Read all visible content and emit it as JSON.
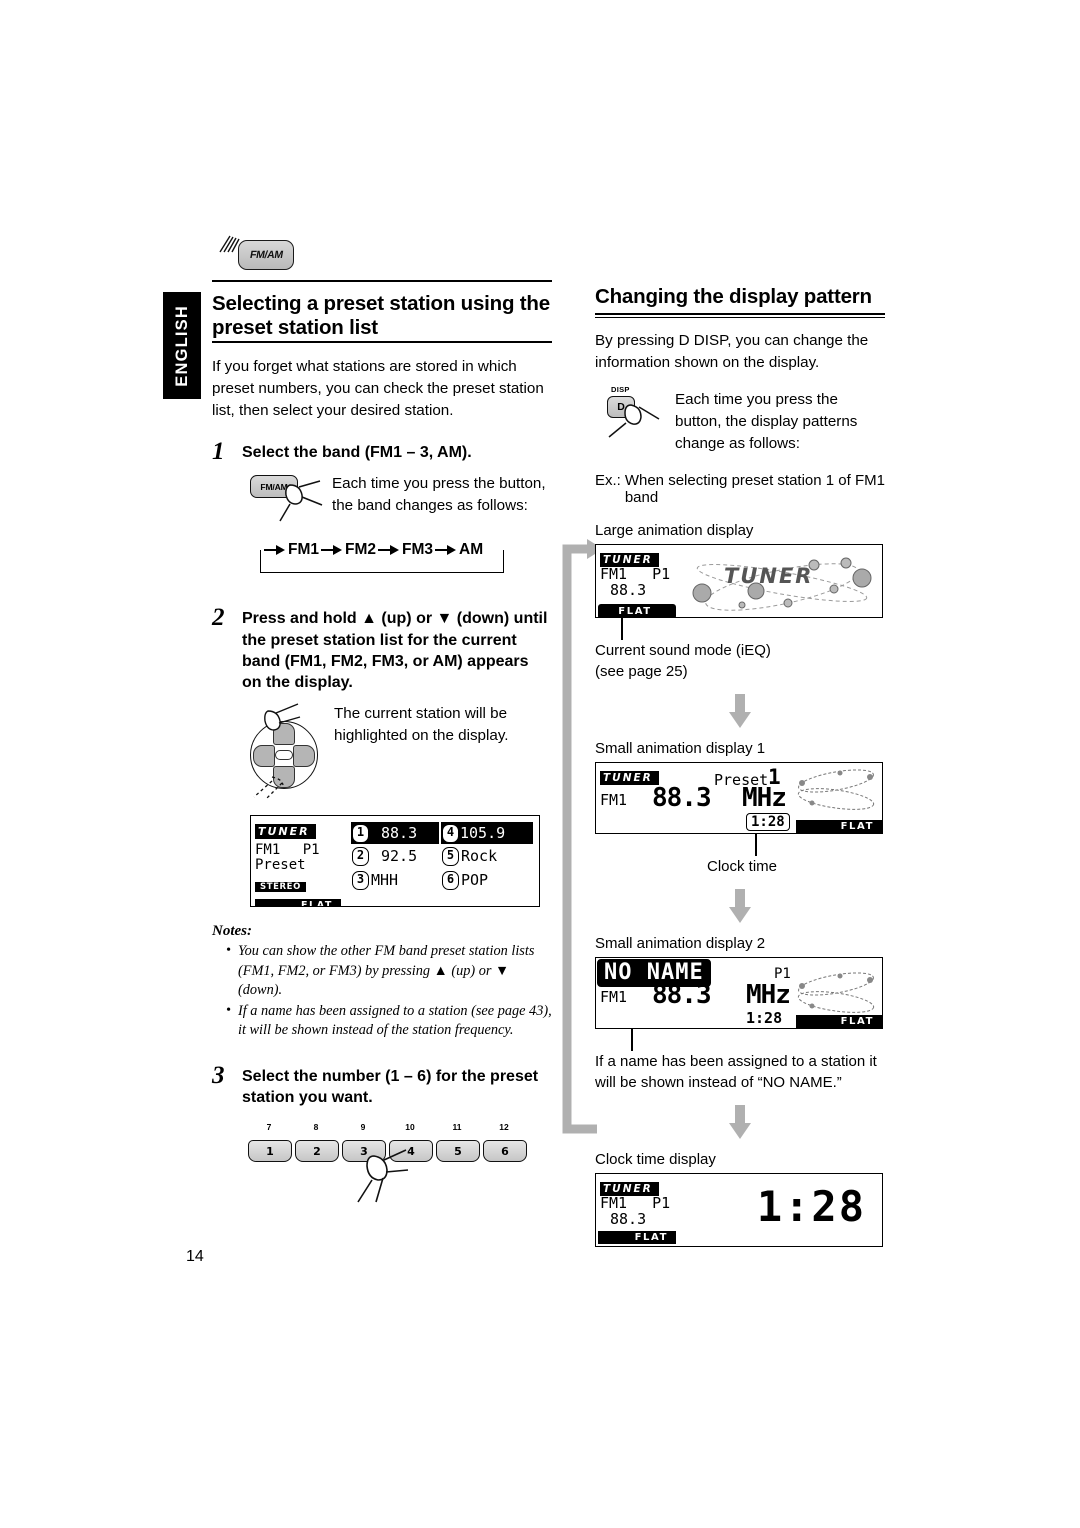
{
  "language_tab": "ENGLISH",
  "page_number": "14",
  "left_column": {
    "remote_button_label": "FM/AM",
    "section_title": "Selecting a preset station using the preset station list",
    "intro": "If you forget what stations are stored in which preset numbers, you can check the preset station list, then select your desired station.",
    "steps": [
      {
        "num": "1",
        "title": "Select the band (FM1 – 3, AM).",
        "button_label": "FM/AM",
        "note": "Each time you press the button, the band changes as follows:",
        "band_flow": [
          "FM1",
          "FM2",
          "FM3",
          "AM"
        ]
      },
      {
        "num": "2",
        "title": "Press and hold ▲ (up) or ▼ (down) until the preset station list for the current band (FM1, FM2, FM3, or AM) appears on the display.",
        "note": "The current station will be highlighted on the display."
      },
      {
        "num": "3",
        "title": "Select the number (1 – 6) for the preset station you want.",
        "numkeys": [
          {
            "top": "7",
            "main": "1"
          },
          {
            "top": "8",
            "main": "2"
          },
          {
            "top": "9",
            "main": "3"
          },
          {
            "top": "10",
            "main": "4"
          },
          {
            "top": "11",
            "main": "5"
          },
          {
            "top": "12",
            "main": "6"
          }
        ]
      }
    ],
    "preset_list_display": {
      "logo": "TUNER",
      "band": "FM1",
      "preset": "P1",
      "mode": "Preset",
      "stereo": "STEREO",
      "sound_mode": "FLAT",
      "entries": [
        {
          "num": "1",
          "value": "88.3",
          "highlighted": true
        },
        {
          "num": "2",
          "value": "92.5",
          "highlighted": false
        },
        {
          "num": "3",
          "value": "MHH",
          "highlighted": false
        },
        {
          "num": "4",
          "value": "105.9",
          "highlighted": false
        },
        {
          "num": "5",
          "value": "Rock",
          "highlighted": false
        },
        {
          "num": "6",
          "value": "POP",
          "highlighted": false
        }
      ]
    },
    "notes_title": "Notes:",
    "notes": [
      "You can show the other FM band preset station lists (FM1, FM2, or FM3) by pressing ▲ (up) or ▼ (down).",
      "If a name has been assigned to a station (see page 43), it will be shown instead of the station frequency."
    ]
  },
  "right_column": {
    "section_title": "Changing the display pattern",
    "intro": "By pressing D DISP, you can change the information shown on the display.",
    "disp_button": {
      "top_label": "DISP",
      "key_label": "D",
      "note": "Each time you press the button, the display patterns change as follows:"
    },
    "example_prefix": "Ex.:",
    "example_text": "When selecting preset station 1 of FM1 band",
    "patterns": [
      {
        "caption": "Large animation display",
        "sub_caption": "Current sound mode (iEQ)\n(see page 25)",
        "display": {
          "logo": "TUNER",
          "band": "FM1",
          "preset": "P1",
          "frequency": "88.3",
          "sound_mode": "FLAT",
          "animation_text": "TUNER"
        }
      },
      {
        "caption": "Small animation display 1",
        "sub_caption": "Clock time",
        "display": {
          "logo": "TUNER",
          "band": "FM1",
          "preset_label": "Preset",
          "preset_number": "1",
          "frequency": "88.3",
          "unit": "MHz",
          "clock": "1:28",
          "sound_mode": "FLAT"
        }
      },
      {
        "caption": "Small animation display 2",
        "sub_caption": "If a name has been assigned to a station it will be shown instead of “NO NAME.”",
        "display": {
          "name": "NO NAME",
          "band": "FM1",
          "preset": "P1",
          "frequency": "88.3",
          "unit": "MHz",
          "clock": "1:28",
          "sound_mode": "FLAT"
        }
      },
      {
        "caption": "Clock time display",
        "display": {
          "logo": "TUNER",
          "band": "FM1",
          "preset": "P1",
          "frequency": "88.3",
          "clock": "1:28",
          "sound_mode": "FLAT"
        }
      }
    ]
  }
}
